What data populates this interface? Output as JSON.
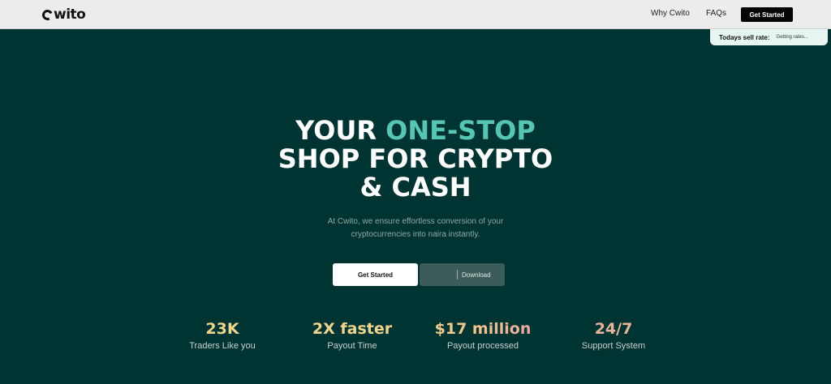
{
  "nav": {
    "logo_text": "wito",
    "links": [
      "Why Cwito",
      "FAQs"
    ],
    "cta_label": "Get Started"
  },
  "rate": {
    "label": "Todays sell rate:",
    "value": "Getting rates..."
  },
  "hero": {
    "line1_white": "YOUR",
    "line1_accent": "ONE-STOP",
    "line2": "SHOP FOR CRYPTO",
    "line3": "& CASH"
  },
  "subtitle": {
    "line1": "At Cwito, we ensure effortless conversion of your",
    "line2": "cryptocurrencies into naira instantly."
  },
  "buttons": {
    "primary": "Get Started",
    "secondary": "Download"
  },
  "stats": [
    {
      "value": "23K",
      "label": "Traders Like you"
    },
    {
      "value": "2X faster",
      "label": "Payout Time"
    },
    {
      "value": "$17 million",
      "label": "Payout processed"
    },
    {
      "value": "24/7",
      "label": "Support System"
    }
  ],
  "colors": {
    "background": "#003432",
    "accent": "#56c5b4",
    "stat_gold": "#f0d58e",
    "stat_pink": "#e8a0a6"
  }
}
